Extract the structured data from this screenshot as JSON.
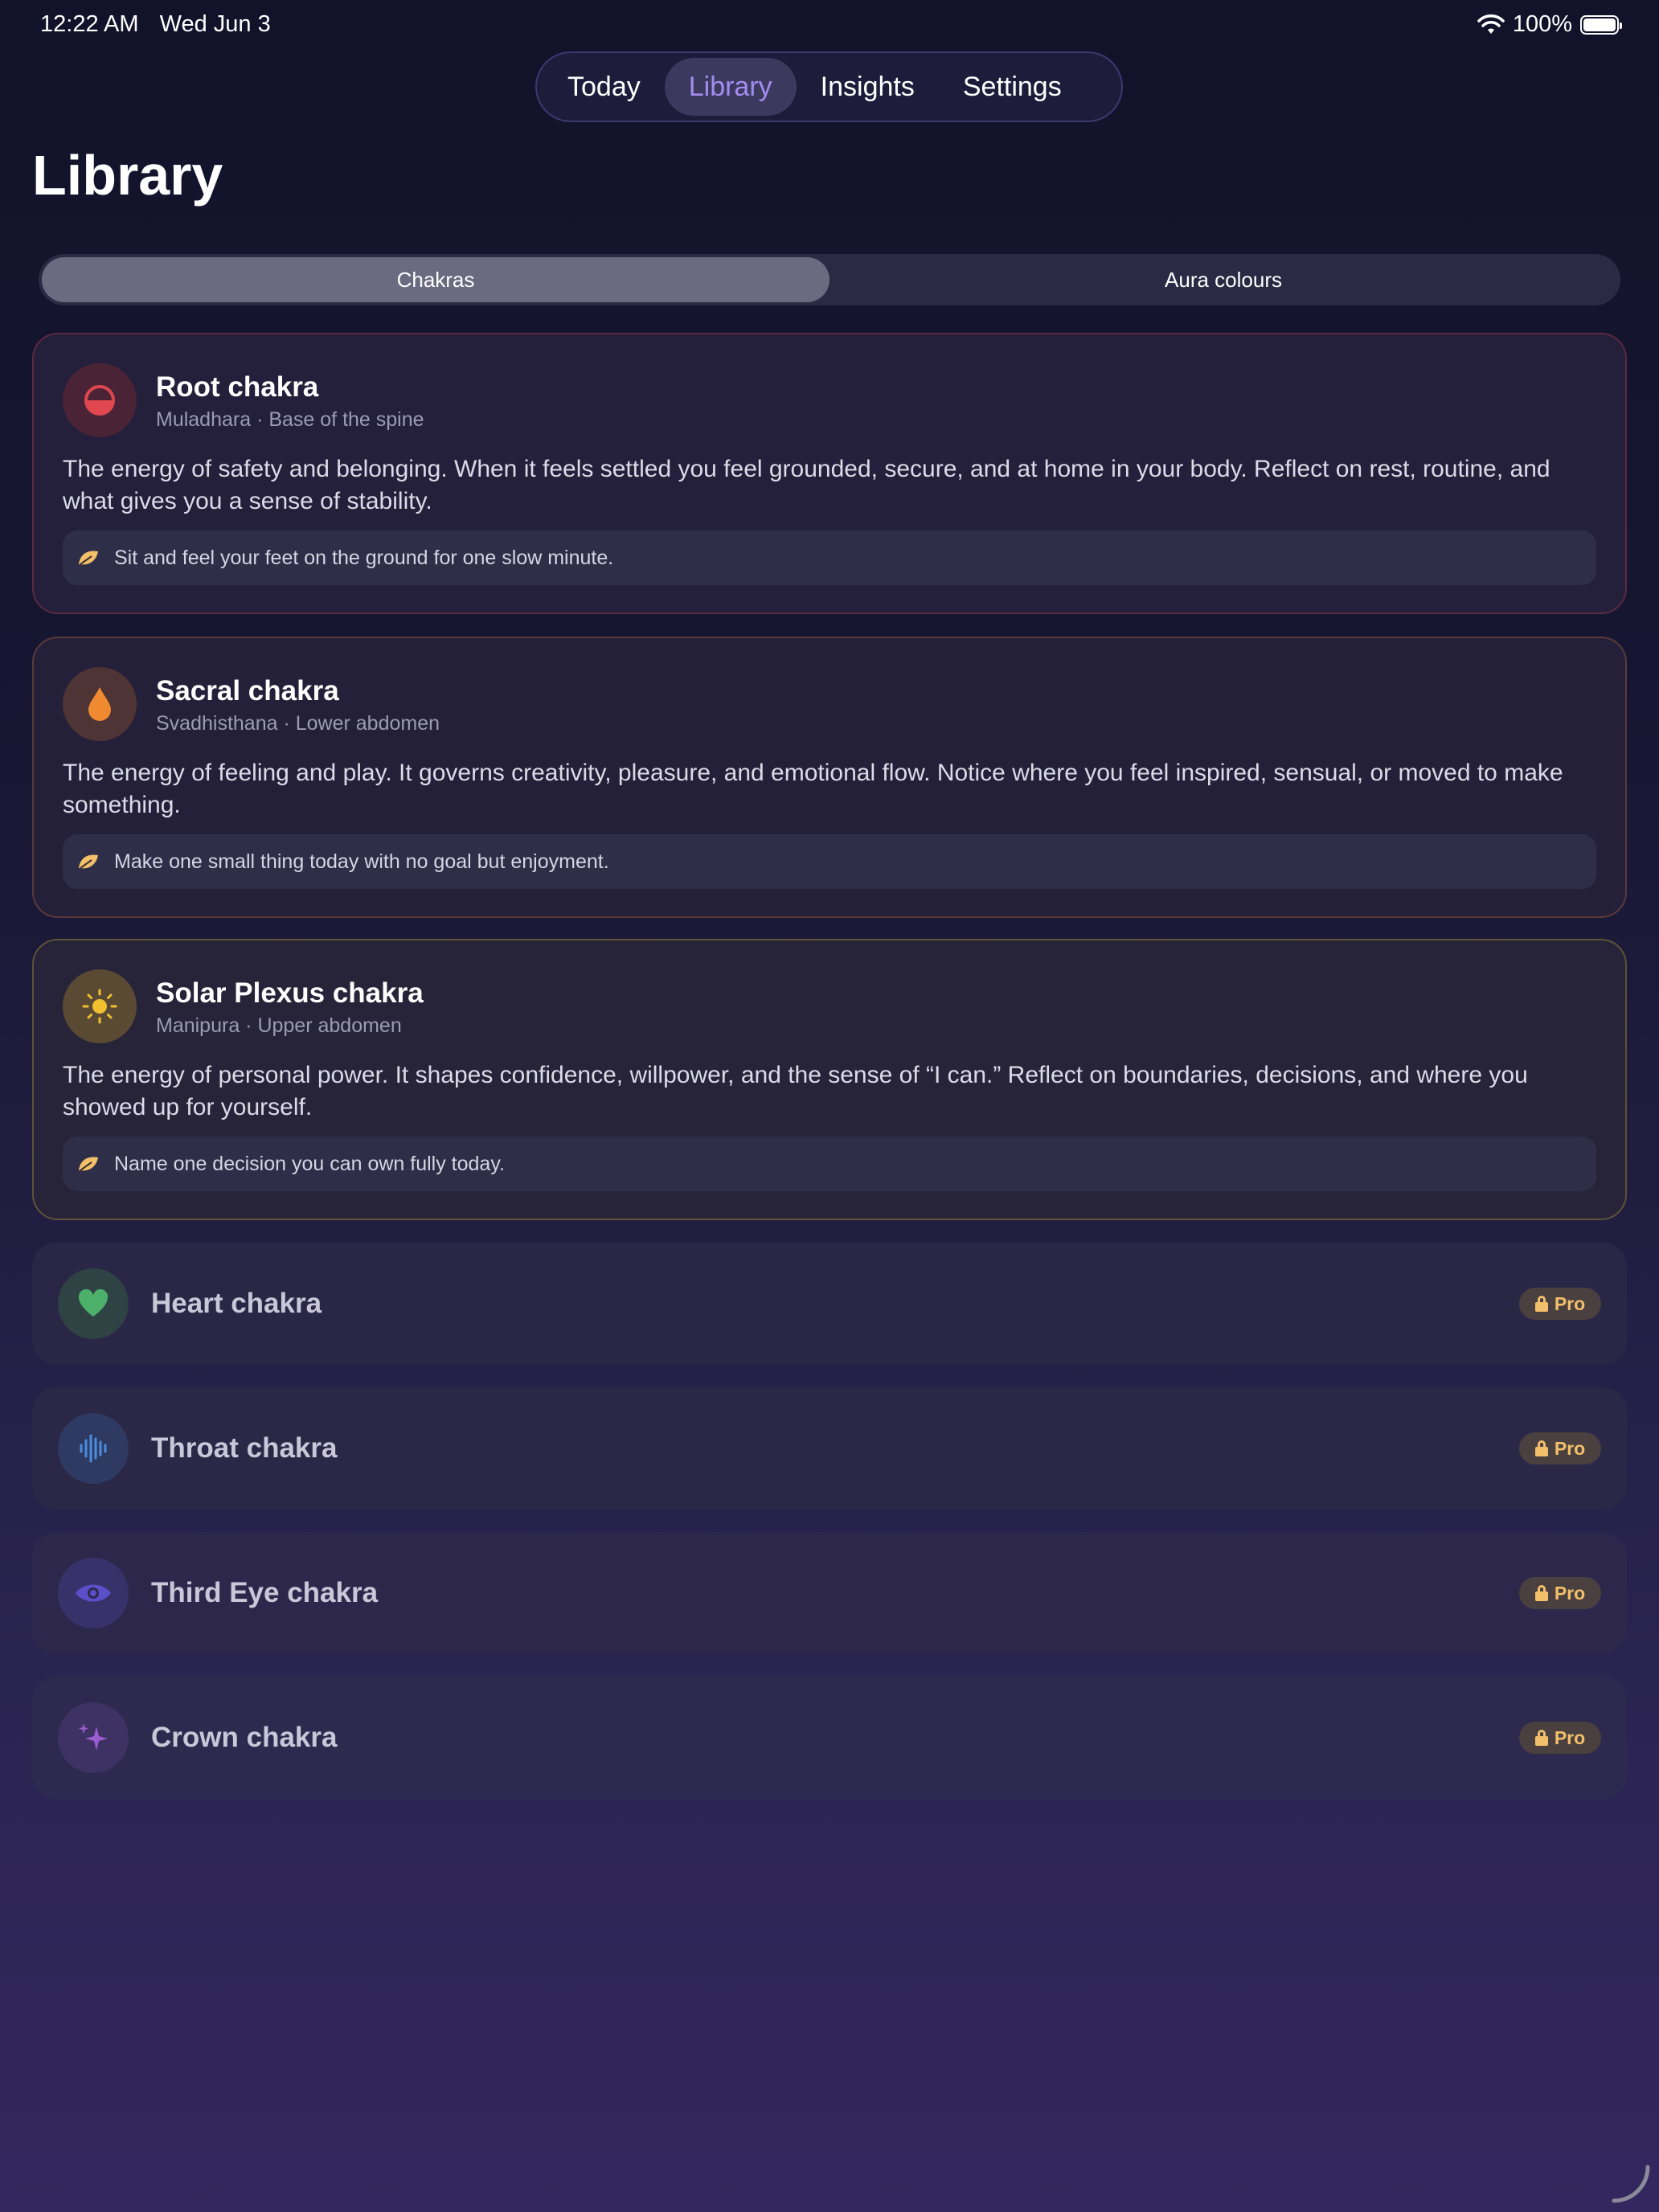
{
  "status_bar": {
    "time": "12:22 AM",
    "date": "Wed Jun 3",
    "battery": "100%"
  },
  "top_tabs": [
    {
      "label": "Today",
      "active": false
    },
    {
      "label": "Library",
      "active": true
    },
    {
      "label": "Insights",
      "active": false
    },
    {
      "label": "Settings",
      "active": false
    }
  ],
  "page_title": "Library",
  "segments": [
    {
      "label": "Chakras",
      "active": true
    },
    {
      "label": "Aura colours",
      "active": false
    }
  ],
  "expanded_cards": [
    {
      "title": "Root chakra",
      "subtitle": "Muladhara · Base of the spine",
      "description": "The energy of safety and belonging. When it feels settled you feel grounded, secure, and at home in your body. Reflect on rest, routine, and what gives you a sense of stability.",
      "tip": "Sit and feel your feet on the ground for one slow minute.",
      "icon": "half-circle-icon",
      "color": "#e0474f"
    },
    {
      "title": "Sacral chakra",
      "subtitle": "Svadhisthana · Lower abdomen",
      "description": "The energy of feeling and play. It governs creativity, pleasure, and emotional flow. Notice where you feel inspired, sensual, or moved to make something.",
      "tip": "Make one small thing today with no goal but enjoyment.",
      "icon": "drop-icon",
      "color": "#f08a30"
    },
    {
      "title": "Solar Plexus chakra",
      "subtitle": "Manipura · Upper abdomen",
      "description": "The energy of personal power. It shapes confidence, willpower, and the sense of “I can.” Reflect on boundaries, decisions, and where you showed up for yourself.",
      "tip": "Name one decision you can own fully today.",
      "icon": "sun-icon",
      "color": "#f0c030"
    }
  ],
  "locked_rows": [
    {
      "title": "Heart chakra",
      "badge": "Pro",
      "icon": "heart-icon",
      "color": "#4caf6a"
    },
    {
      "title": "Throat chakra",
      "badge": "Pro",
      "icon": "waveform-icon",
      "color": "#4a8ee0"
    },
    {
      "title": "Third Eye chakra",
      "badge": "Pro",
      "icon": "eye-icon",
      "color": "#5a4fc8"
    },
    {
      "title": "Crown chakra",
      "badge": "Pro",
      "icon": "sparkles-icon",
      "color": "#9a5cd0"
    }
  ]
}
